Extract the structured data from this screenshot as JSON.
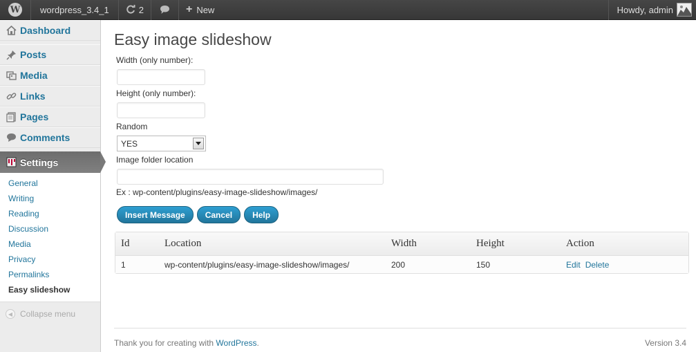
{
  "adminbar": {
    "site_name": "wordpress_3.4_1",
    "updates_count": "2",
    "new_label": "New",
    "howdy": "Howdy, admin"
  },
  "sidebar": {
    "dashboard": "Dashboard",
    "items": [
      {
        "label": "Posts",
        "icon": "pin-icon"
      },
      {
        "label": "Media",
        "icon": "media-icon"
      },
      {
        "label": "Links",
        "icon": "link-icon"
      },
      {
        "label": "Pages",
        "icon": "pages-icon"
      },
      {
        "label": "Comments",
        "icon": "comments-icon"
      }
    ],
    "active": "Settings",
    "submenu": [
      "General",
      "Writing",
      "Reading",
      "Discussion",
      "Media",
      "Privacy",
      "Permalinks",
      "Easy slideshow"
    ],
    "collapse": "Collapse menu"
  },
  "main": {
    "title": "Easy image slideshow",
    "width_label": "Width (only number):",
    "width_value": "",
    "height_label": "Height (only number):",
    "height_value": "",
    "random_label": "Random",
    "random_value": "YES",
    "folder_label": "Image folder location",
    "folder_value": "",
    "example": "Ex : wp-content/plugins/easy-image-slideshow/images/",
    "buttons": {
      "insert": "Insert Message",
      "cancel": "Cancel",
      "help": "Help"
    },
    "table": {
      "headers": [
        "Id",
        "Location",
        "Width",
        "Height",
        "Action"
      ],
      "rows": [
        {
          "id": "1",
          "location": "wp-content/plugins/easy-image-slideshow/images/",
          "width": "200",
          "height": "150",
          "edit": "Edit",
          "delete": "Delete"
        }
      ]
    }
  },
  "footer": {
    "thanks": "Thank you for creating with ",
    "link": "WordPress",
    "period": ".",
    "version": "Version 3.4"
  },
  "colors": {
    "link": "#21759b",
    "adminbar": "#464646",
    "active_menu": "#6d6d6d"
  }
}
